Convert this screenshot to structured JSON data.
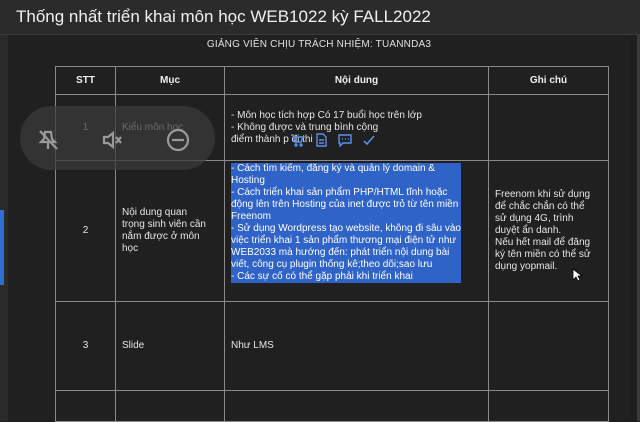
{
  "window": {
    "title": "Thống nhất triển khai môn học WEB1022 kỳ FALL2022"
  },
  "doc": {
    "responsible": "GIẢNG VIÊN CHỊU TRÁCH NHIỆM:  TUANNDA3",
    "headers": {
      "stt": "STT",
      "muc": "Mục",
      "noi_dung": "Nội dung",
      "ghi_chu": "Ghi chú"
    },
    "rows": [
      {
        "stt": "1",
        "muc": "Kiểu môn học",
        "noi_dung": [
          "- Môn học tích hợp Có 17 buổi học trên lớp",
          "- Không được                    và trung bình cộng",
          "điểm thành p                       đi thi"
        ],
        "ghi_chu": ""
      },
      {
        "stt": "2",
        "muc": [
          "Nội dung quan",
          "trọng sinh viên cần",
          "nắm được ở môn",
          "học"
        ],
        "noi_dung": [
          "- Cách tìm kiếm, đăng ký và quản lý domain &",
          "Hosting",
          "- Cách triển khai sản phẩm PHP/HTML tĩnh hoặc",
          "động lên trên Hosting của inet được trỏ từ tên miền",
          "Freenom",
          "- Sử dụng Wordpress tạo website, không đi sâu vào",
          "việc triển khai 1 sản phẩm thương mại điện tử như",
          "WEB2033 mà hướng đến: phát triển nội dung bài",
          "viết, công cụ plugin thống kê;theo dõi;sao lưu",
          "- Các sự cố có thể gặp phải khi triển khai"
        ],
        "ghi_chu": [
          "Freenom khi sử dụng",
          "để chắc chắn có thể",
          "sử dụng 4G, trình",
          "duyệt ẩn danh.",
          "Nếu hết mail để đăng",
          "ký tên miền có thể sử",
          "dụng yopmail."
        ]
      },
      {
        "stt": "3",
        "muc": "Slide",
        "noi_dung": "Như LMS",
        "ghi_chu": ""
      }
    ]
  },
  "overlay": {
    "left_icons": [
      "pin-off-icon",
      "mute-icon",
      "minus-circle-icon"
    ],
    "mini_icons": [
      "cart-icon",
      "edit-icon",
      "comment-icon",
      "check-icon"
    ]
  },
  "colors": {
    "highlight": "#2f63c8",
    "background": "#1e1e1e",
    "border": "#8a8a8a"
  }
}
